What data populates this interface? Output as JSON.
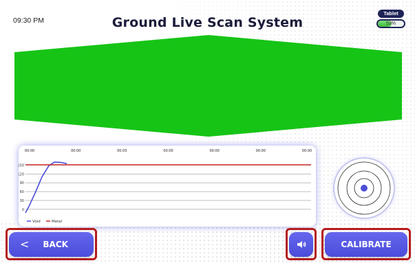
{
  "header": {
    "time": "09:30 PM",
    "title": "Ground Live Scan System",
    "device_label": "Tablet",
    "battery_text": "53%",
    "battery_level": 0.53,
    "battery_color": "#4cc24c"
  },
  "scan_view": {
    "color": "#16c416"
  },
  "chart": {
    "time_labels": [
      "00:00",
      "00:00",
      "00:00",
      "00:00",
      "00:00",
      "00:00",
      "00:00"
    ]
  },
  "chart_data": {
    "type": "line",
    "x_ticks": [
      "00:00",
      "00:00",
      "00:00",
      "00:00",
      "00:00",
      "00:00",
      "00:00"
    ],
    "y_ticks": [
      0,
      30,
      60,
      90,
      120,
      150
    ],
    "ylim": [
      -12,
      165
    ],
    "x_range": [
      0,
      415
    ],
    "grid": true,
    "legend_position": "bottom-left",
    "series": [
      {
        "name": "Void",
        "color": "#4b4cd9",
        "points": [
          [
            0,
            -12
          ],
          [
            5,
            10
          ],
          [
            14,
            55
          ],
          [
            24,
            110
          ],
          [
            34,
            148
          ],
          [
            42,
            160
          ],
          [
            52,
            159
          ],
          [
            60,
            155
          ]
        ]
      },
      {
        "name": "Metal",
        "color": "#cc2a2a",
        "points": [
          [
            0,
            151
          ],
          [
            415,
            151
          ]
        ]
      }
    ]
  },
  "target": {
    "dot_color": "#4f4fd6"
  },
  "buttons": {
    "back_label": "BACK",
    "calibrate_label": "CALIBRATE",
    "sound_icon": "speaker-icon",
    "back_icon": "chevron-left-icon",
    "accent": "#5656e0",
    "outline": "#b51c1c"
  }
}
